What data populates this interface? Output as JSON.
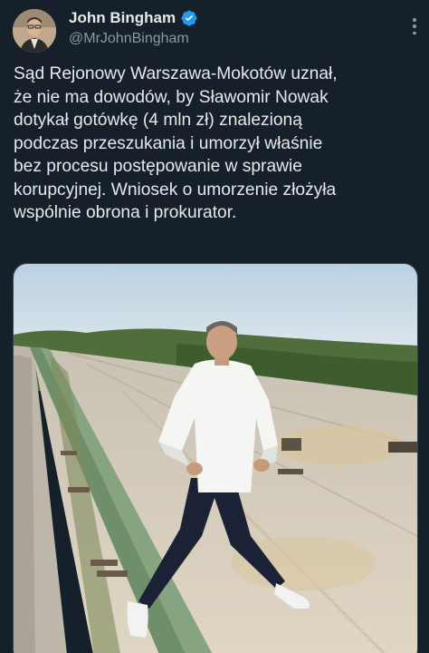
{
  "author": {
    "display_name": "John Bingham",
    "handle": "@MrJohnBingham",
    "verified": true,
    "verified_color": "#1d9bf0"
  },
  "icons": {
    "verified": "verified-badge-icon",
    "more": "more-options-icon"
  },
  "tweet": {
    "text": "Sąd Rejonowy Warszawa-Mokotów uznał,\nże nie ma dowodów, by Sławomir Nowak\ndotykał gotówkę (4 mln zł) znalezioną\npodczas przeszukania i umorzył właśnie\nbez procesu postępowanie w sprawie\nkorupcyjnej. Wniosek o umorzenie złożyła\nwspólnie obrona i prokurator."
  },
  "colors": {
    "background": "#15202b",
    "text": "#e7e9ea",
    "secondary_text": "#8b98a5"
  }
}
